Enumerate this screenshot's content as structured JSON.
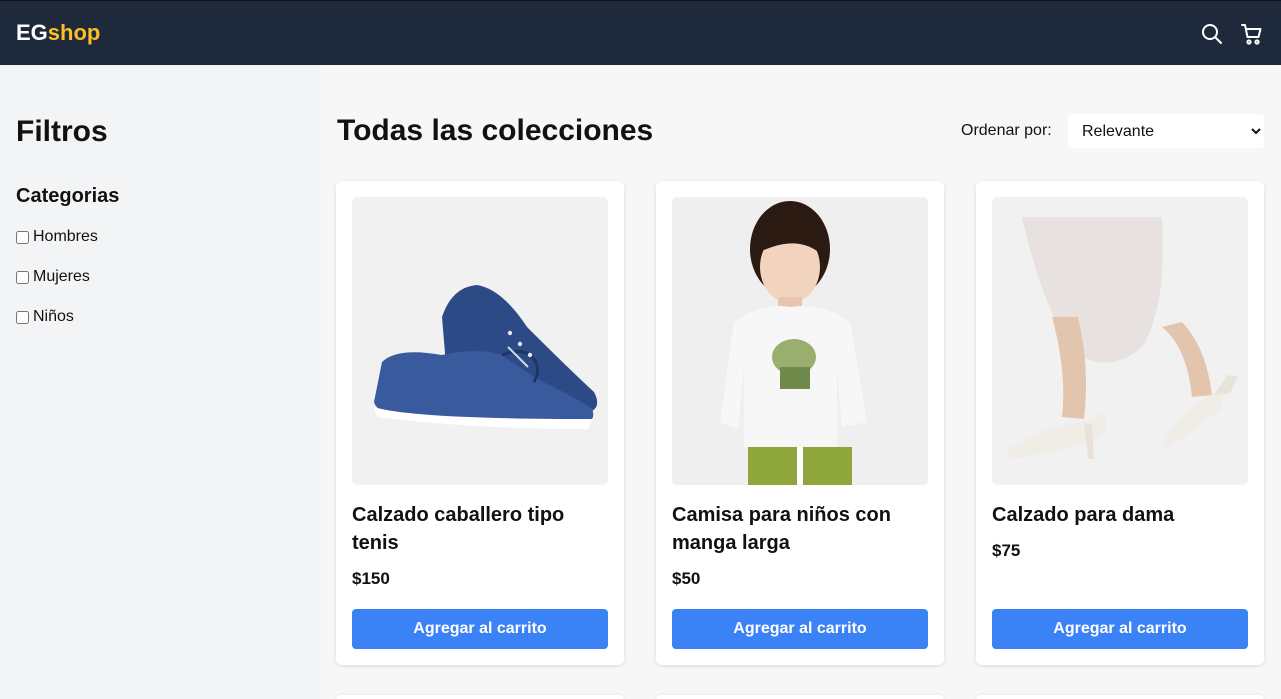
{
  "header": {
    "logo_eg": "EG",
    "logo_shop": "shop",
    "icons": [
      "search-icon",
      "cart-icon"
    ]
  },
  "sidebar": {
    "title": "Filtros",
    "section_title": "Categorias",
    "categories": [
      {
        "label": "Hombres",
        "checked": false
      },
      {
        "label": "Mujeres",
        "checked": false
      },
      {
        "label": "Niños",
        "checked": false
      }
    ]
  },
  "main": {
    "title": "Todas las colecciones",
    "sort_label": "Ordenar por:",
    "sort_selected": "Relevante"
  },
  "products": [
    {
      "name": "Calzado caballero tipo tenis",
      "price": "$150",
      "button": "Agregar al carrito",
      "image": "blue-sneakers"
    },
    {
      "name": "Camisa para niños con manga larga",
      "price": "$50",
      "button": "Agregar al carrito",
      "image": "boy-long-sleeve-shirt"
    },
    {
      "name": "Calzado para dama",
      "price": "$75",
      "button": "Agregar al carrito",
      "image": "white-heels"
    }
  ],
  "colors": {
    "navbar": "#1e293b",
    "logo_accent": "#fbbf24",
    "button": "#3b82f6"
  }
}
